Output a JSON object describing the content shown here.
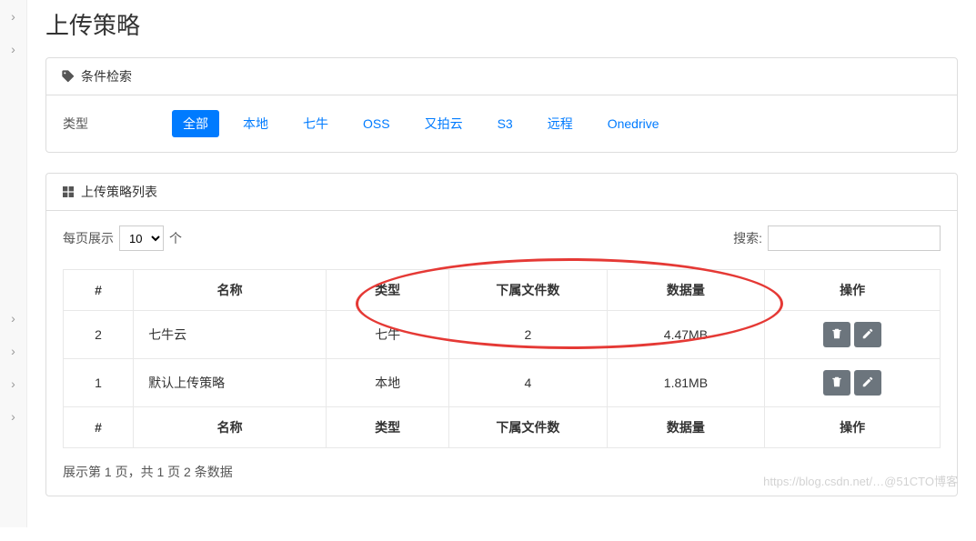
{
  "page": {
    "title": "上传策略"
  },
  "filter_card": {
    "header_label": "条件检索",
    "type_label": "类型",
    "options": [
      "全部",
      "本地",
      "七牛",
      "OSS",
      "又拍云",
      "S3",
      "远程",
      "Onedrive"
    ],
    "active_option": "全部"
  },
  "list_card": {
    "header_label": "上传策略列表",
    "per_page_prefix": "每页展示",
    "per_page_value": "10",
    "per_page_suffix": "个",
    "search_label": "搜索:",
    "columns": [
      "#",
      "名称",
      "类型",
      "下属文件数",
      "数据量",
      "操作"
    ],
    "rows": [
      {
        "index": "2",
        "name": "七牛云",
        "type": "七牛",
        "file_count": "2",
        "size": "4.47MB"
      },
      {
        "index": "1",
        "name": "默认上传策略",
        "type": "本地",
        "file_count": "4",
        "size": "1.81MB"
      }
    ],
    "footer_info": "展示第 1 页，共 1 页 2 条数据"
  },
  "watermark": "https://blog.csdn.net/…@51CTO博客"
}
